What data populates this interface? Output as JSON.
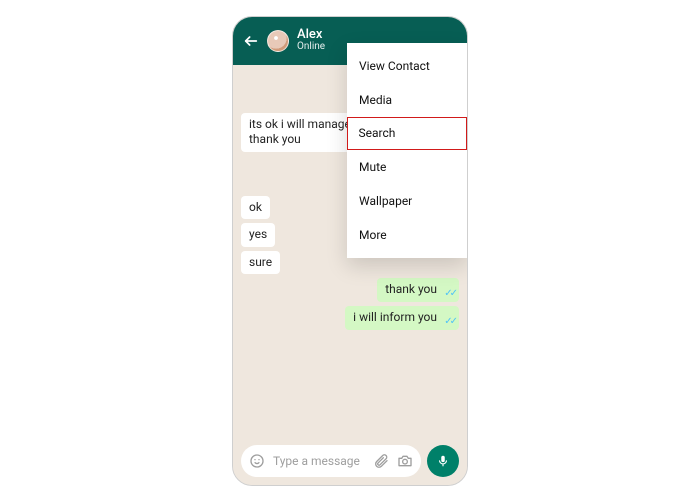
{
  "colors": {
    "header_bg": "#075e54",
    "chat_bg": "#efe7de",
    "bubble_out": "#d4f8c4",
    "bubble_in": "#ffffff",
    "mic_bg": "#008069",
    "tick_read": "#4fc3f7",
    "menu_highlight_border": "#d11a1a"
  },
  "header": {
    "name": "Alex",
    "status": "Online"
  },
  "menu": {
    "items": [
      {
        "label": "View Contact",
        "selected": false
      },
      {
        "label": "Media",
        "selected": false
      },
      {
        "label": "Search",
        "selected": true
      },
      {
        "label": "Mute",
        "selected": false
      },
      {
        "label": "Wallpaper",
        "selected": false
      },
      {
        "label": "More",
        "selected": false
      }
    ]
  },
  "messages": [
    {
      "dir": "out",
      "text": "",
      "blank": true,
      "ticks": false
    },
    {
      "dir": "out",
      "text": "",
      "blank": true,
      "ticks": false
    },
    {
      "dir": "in",
      "text": "its ok i will manage\nthank you",
      "blank": false,
      "ticks": false
    },
    {
      "dir": "out",
      "text": "",
      "blank": true,
      "ticks": true,
      "ticks_outside": true
    },
    {
      "dir": "out",
      "text": "",
      "blank": true,
      "ticks": true,
      "ticks_outside": true
    },
    {
      "dir": "in",
      "text": "ok",
      "blank": false,
      "ticks": false
    },
    {
      "dir": "in",
      "text": "yes",
      "blank": false,
      "ticks": false
    },
    {
      "dir": "in",
      "text": "sure",
      "blank": false,
      "ticks": false
    },
    {
      "dir": "out",
      "text": "thank you",
      "blank": false,
      "ticks": true
    },
    {
      "dir": "out",
      "text": "i will inform you",
      "blank": false,
      "ticks": true
    }
  ],
  "input": {
    "placeholder": "Type a message"
  }
}
